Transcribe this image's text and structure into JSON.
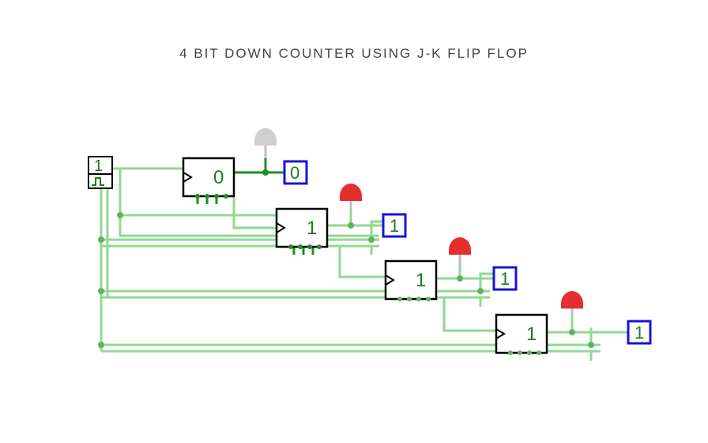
{
  "title": "4 BIT  DOWN COUNTER USING  J-K FLIP FLOP",
  "input": {
    "value": "1"
  },
  "flipflops": [
    {
      "q": "0",
      "led_on": false,
      "probe": "0"
    },
    {
      "q": "1",
      "led_on": true,
      "probe": "1"
    },
    {
      "q": "1",
      "led_on": true,
      "probe": "1"
    },
    {
      "q": "1",
      "led_on": true,
      "probe": "1"
    }
  ],
  "colors": {
    "wire_on": "#1f8d1f",
    "wire_off": "#92d892",
    "led_on": "#e62e2e",
    "led_off": "#cfcfcf",
    "probe": "#1414d8"
  }
}
